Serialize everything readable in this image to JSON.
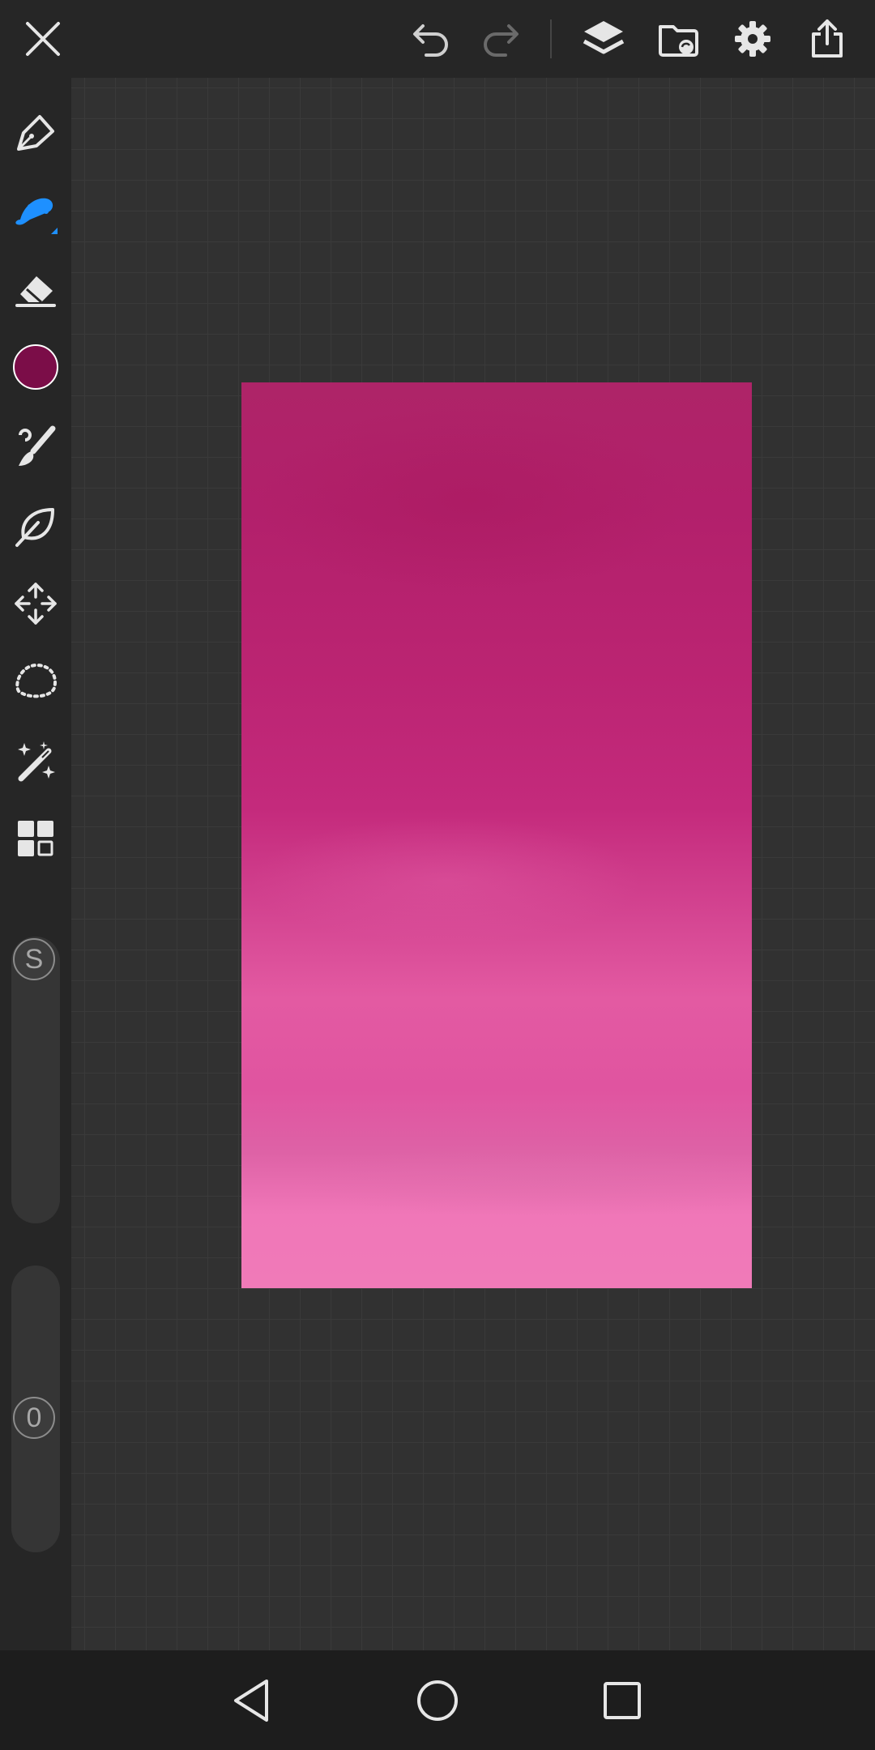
{
  "toolbar": {
    "close_icon": "close-icon",
    "undo_icon": "undo-icon",
    "redo_icon": "redo-icon",
    "layers_icon": "layers-icon",
    "gallery_icon": "folder-sync-icon",
    "settings_icon": "gear-icon",
    "export_icon": "share-upload-icon"
  },
  "tools": [
    {
      "name": "pen",
      "icon": "pen-nib-icon"
    },
    {
      "name": "fill",
      "icon": "fill-bucket-icon",
      "active": true
    },
    {
      "name": "eraser",
      "icon": "eraser-icon"
    },
    {
      "name": "color",
      "icon": "color-swatch",
      "value": "#7b0d48"
    },
    {
      "name": "brush",
      "icon": "paint-brush-icon"
    },
    {
      "name": "smudge",
      "icon": "leaf-icon"
    },
    {
      "name": "transform",
      "icon": "move-arrows-icon"
    },
    {
      "name": "lasso",
      "icon": "lasso-icon"
    },
    {
      "name": "magic-wand",
      "icon": "magic-wand-icon"
    },
    {
      "name": "more-tools",
      "icon": "grid-icon"
    }
  ],
  "size_slider": {
    "label": "S",
    "value": 0.0
  },
  "opacity_slider": {
    "label": "0",
    "value": 0.0
  },
  "colors": {
    "accent": "#1e90ff",
    "current": "#7b0d48",
    "toolbar_bg": "#262626"
  },
  "navbar": {
    "back_icon": "back-triangle-icon",
    "home_icon": "home-circle-icon",
    "recents_icon": "recents-square-icon"
  }
}
